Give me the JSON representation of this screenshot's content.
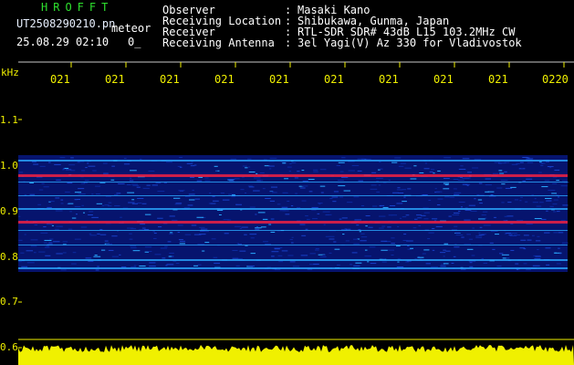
{
  "header": {
    "brand": "HROFFT",
    "filename": "UT2508290210.pn",
    "mode": "meteor",
    "datetime": "25.08.29 02:10",
    "zero": "0_",
    "info": [
      {
        "label": "Observer",
        "value": "Masaki Kano"
      },
      {
        "label": "Receiving Location",
        "value": "Shibukawa, Gunma, Japan"
      },
      {
        "label": "Receiver",
        "value": "RTL-SDR SDR# 43dB L15 103.2MHz CW"
      },
      {
        "label": "Receiving Antenna",
        "value": "3el Yagi(V) Az 330 for Vladivostok"
      }
    ]
  },
  "axis": {
    "unit": "kHz",
    "time_ticks": [
      "021",
      "021",
      "021",
      "021",
      "021",
      "021",
      "021",
      "021",
      "021",
      "0220"
    ],
    "freq_labels": [
      "1.1",
      "1.0",
      "0.9",
      "0.8",
      "0.7",
      "0.6"
    ]
  },
  "colors": {
    "background": "#000000",
    "text": "#ffffff",
    "axis": "#f0f000",
    "brand": "#2ee02e",
    "signal_low": "#0a1a8a",
    "signal_mid": "#2aa8ff",
    "signal_hot": "#ff2040"
  }
}
